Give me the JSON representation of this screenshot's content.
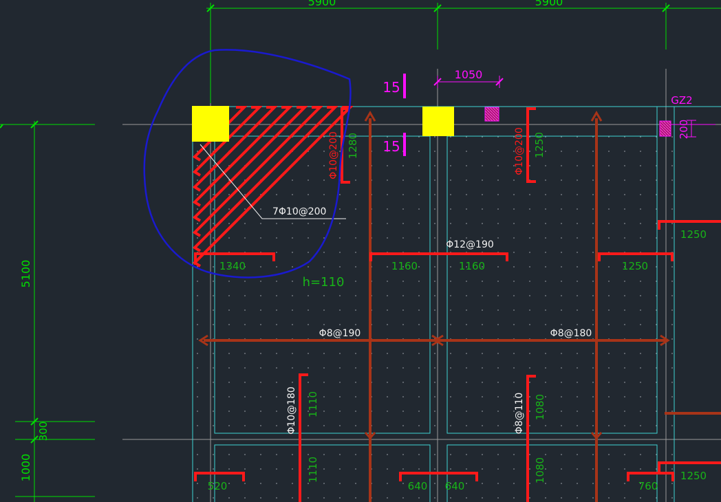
{
  "colors": {
    "background": "#212830",
    "dimension": "#00e000",
    "grid_axis": "#9a9a9a",
    "beam_outline": "#3ed3d3",
    "top_rebar": "#ff1a1a",
    "bottom_rebar": "#a83418",
    "column": "#ffff00",
    "annotation_magenta": "#ff10ff",
    "cloud": "#1a1acf",
    "label_white": "#f2f2f2",
    "text_green": "#18b418"
  },
  "dimensions": {
    "top_span_left": "5900",
    "top_span_right": "5900",
    "left_span_upper": "5100",
    "left_span_mid": "300",
    "left_span_lower": "1000",
    "top_detail_width": "1050",
    "gz_offset": "200"
  },
  "labels": {
    "slab_thickness": "h=110",
    "corner_callout": "7Φ10@200",
    "column_tag": "GZ2",
    "offset_upper": "15",
    "offset_lower": "15"
  },
  "top_bars": {
    "rebar_a": "Φ10@200",
    "len_a": "1280",
    "rebar_b": "Φ10@200",
    "len_b": "1250",
    "rebar_c": "Φ10@180",
    "len_c_upper": "1110",
    "len_c_lower": "1110",
    "rebar_d": "Φ8@110",
    "len_d_upper": "1080",
    "len_d_lower": "1080",
    "rebar_mid": "Φ12@190",
    "len_1340": "1340",
    "len_1160_left": "1160",
    "len_1160_right": "1160",
    "len_1250_lower": "1250",
    "len_1250_right": "1250",
    "len_1250_far": "1250",
    "len_520": "520",
    "len_640_left": "640",
    "len_640_right": "640",
    "len_760": "760"
  },
  "bottom_bars": {
    "left": "Φ8@190",
    "right": "Φ8@180"
  }
}
